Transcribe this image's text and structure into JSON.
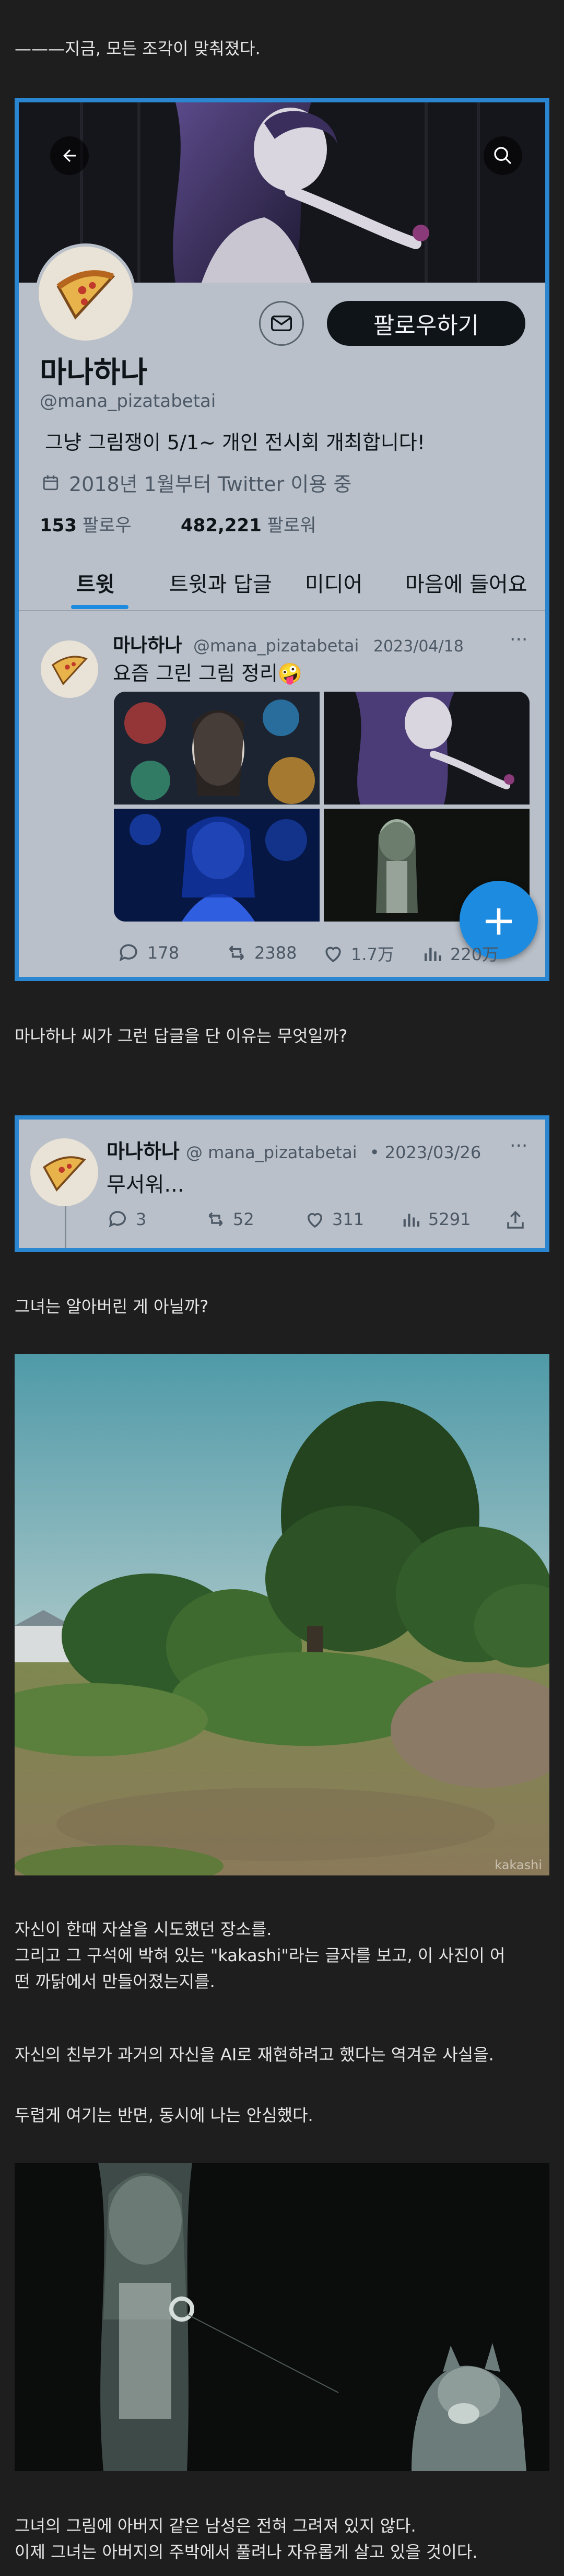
{
  "intro_text": "———지금, 모든 조각이 맞춰졌다.",
  "profile": {
    "name": "마나하나",
    "handle": "@mana_pizatabetai",
    "bio": "그냥 그림쟁이 5/1~ 개인 전시회 개최합니다!",
    "joined": "2018년 1월부터 Twitter 이용 중",
    "following_count": "153",
    "following_label": "팔로우",
    "followers_count": "482,221",
    "followers_label": "팔로워",
    "follow_button": "팔로우하기",
    "tabs": [
      "트윗",
      "트윗과 답글",
      "미디어",
      "마음에 들어요"
    ],
    "tweet": {
      "name": "마나하나",
      "handle": "@mana_pizatabetai",
      "date": "2023/04/18",
      "more": "···",
      "text": "요즘 그린 그림 정리🤪",
      "replies": "178",
      "retweets": "2388",
      "likes": "1.7万",
      "views": "220万"
    }
  },
  "question_text": "마나하나 씨가 그런 답글을 단 이유는 무엇일까?",
  "reply_tweet": {
    "name": "마나하나",
    "handle": "@ mana_pizatabetai",
    "date": "• 2023/03/26",
    "more": "···",
    "text": "무서워...",
    "replies": "3",
    "retweets": "52",
    "likes": "311",
    "views": "5291"
  },
  "realize_text": "그녀는 알아버린 게 아닐까?",
  "photo_watermark": "kakashi",
  "para1_line1": "자신이 한때 자살을 시도했던 장소를.",
  "para1_line2": "그리고 그 구석에 박혀 있는 \"kakashi\"라는 글자를 보고, 이 사진이 어",
  "para1_line3": "떤 까닭에서 만들어졌는지를.",
  "para2": "자신의 친부가 과거의 자신을 AI로 재현하려고 했다는 역겨운 사실을.",
  "para3": "두렵게 여기는 반면, 동시에 나는 안심했다.",
  "final_line1": "그녀의 그림에 아버지 같은 남성은 전혀 그려져 있지 않다.",
  "final_line2": "이제 그녀는 아버지의 주박에서 풀려나 자유롭게 살고 있을 것이다.",
  "colors": {
    "accent_blue": "#2a86d0",
    "fab_blue": "#1d8ce0",
    "page_bg": "#1e1e1e"
  }
}
